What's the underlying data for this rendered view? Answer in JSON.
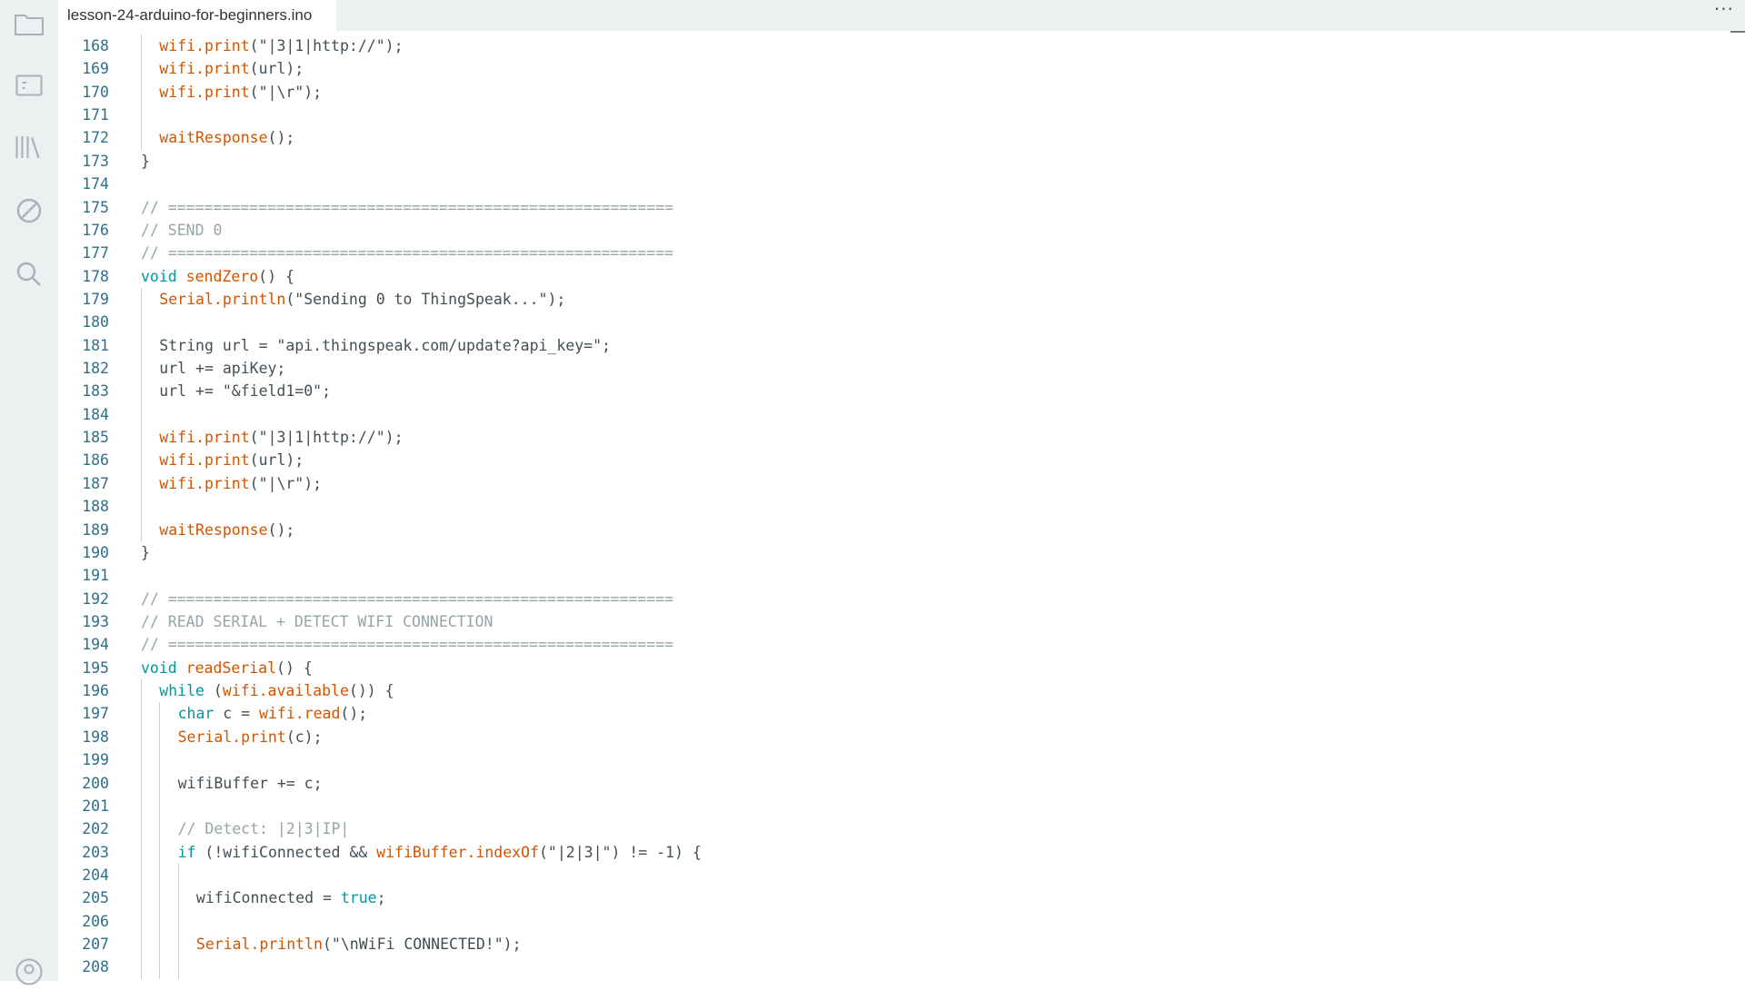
{
  "tab": {
    "filename": "lesson-24-arduino-for-beginners.ino",
    "more_label": "···"
  },
  "sidebar": {
    "items": [
      {
        "name": "folder-icon"
      },
      {
        "name": "board-icon"
      },
      {
        "name": "library-icon"
      },
      {
        "name": "debug-icon"
      },
      {
        "name": "search-icon"
      },
      {
        "name": "profile-icon"
      }
    ]
  },
  "code": {
    "lines": [
      {
        "n": "168",
        "indent": 1,
        "tokens": [
          [
            "fn",
            "wifi.print"
          ],
          [
            "p",
            "(\"|3|1|http://\");"
          ]
        ]
      },
      {
        "n": "169",
        "indent": 1,
        "tokens": [
          [
            "fn",
            "wifi.print"
          ],
          [
            "p",
            "(url);"
          ]
        ]
      },
      {
        "n": "170",
        "indent": 1,
        "tokens": [
          [
            "fn",
            "wifi.print"
          ],
          [
            "p",
            "(\"|\\r\");"
          ]
        ]
      },
      {
        "n": "171",
        "indent": 1,
        "tokens": []
      },
      {
        "n": "172",
        "indent": 1,
        "tokens": [
          [
            "fn",
            "waitResponse"
          ],
          [
            "p",
            "();"
          ]
        ]
      },
      {
        "n": "173",
        "indent": 0,
        "tokens": [
          [
            "p",
            "}"
          ]
        ]
      },
      {
        "n": "174",
        "indent": 0,
        "tokens": []
      },
      {
        "n": "175",
        "indent": 0,
        "tokens": [
          [
            "cm",
            "// ========================================================"
          ]
        ]
      },
      {
        "n": "176",
        "indent": 0,
        "tokens": [
          [
            "cm",
            "// SEND 0"
          ]
        ]
      },
      {
        "n": "177",
        "indent": 0,
        "tokens": [
          [
            "cm",
            "// ========================================================"
          ]
        ]
      },
      {
        "n": "178",
        "indent": 0,
        "tokens": [
          [
            "kw",
            "void "
          ],
          [
            "fn",
            "sendZero"
          ],
          [
            "p",
            "() {"
          ]
        ]
      },
      {
        "n": "179",
        "indent": 1,
        "tokens": [
          [
            "fn",
            "Serial.println"
          ],
          [
            "p",
            "(\"Sending 0 to ThingSpeak...\");"
          ]
        ]
      },
      {
        "n": "180",
        "indent": 1,
        "tokens": []
      },
      {
        "n": "181",
        "indent": 1,
        "tokens": [
          [
            "p",
            "String url = \"api.thingspeak.com/update?api_key=\";"
          ]
        ]
      },
      {
        "n": "182",
        "indent": 1,
        "tokens": [
          [
            "p",
            "url += apiKey;"
          ]
        ]
      },
      {
        "n": "183",
        "indent": 1,
        "tokens": [
          [
            "p",
            "url += \"&field1=0\";"
          ]
        ]
      },
      {
        "n": "184",
        "indent": 1,
        "tokens": []
      },
      {
        "n": "185",
        "indent": 1,
        "tokens": [
          [
            "fn",
            "wifi.print"
          ],
          [
            "p",
            "(\"|3|1|http://\");"
          ]
        ]
      },
      {
        "n": "186",
        "indent": 1,
        "tokens": [
          [
            "fn",
            "wifi.print"
          ],
          [
            "p",
            "(url);"
          ]
        ]
      },
      {
        "n": "187",
        "indent": 1,
        "tokens": [
          [
            "fn",
            "wifi.print"
          ],
          [
            "p",
            "(\"|\\r\");"
          ]
        ]
      },
      {
        "n": "188",
        "indent": 1,
        "tokens": []
      },
      {
        "n": "189",
        "indent": 1,
        "tokens": [
          [
            "fn",
            "waitResponse"
          ],
          [
            "p",
            "();"
          ]
        ]
      },
      {
        "n": "190",
        "indent": 0,
        "tokens": [
          [
            "p",
            "}"
          ]
        ]
      },
      {
        "n": "191",
        "indent": 0,
        "tokens": []
      },
      {
        "n": "192",
        "indent": 0,
        "tokens": [
          [
            "cm",
            "// ========================================================"
          ]
        ]
      },
      {
        "n": "193",
        "indent": 0,
        "tokens": [
          [
            "cm",
            "// READ SERIAL + DETECT WIFI CONNECTION"
          ]
        ]
      },
      {
        "n": "194",
        "indent": 0,
        "tokens": [
          [
            "cm",
            "// ========================================================"
          ]
        ]
      },
      {
        "n": "195",
        "indent": 0,
        "tokens": [
          [
            "kw",
            "void "
          ],
          [
            "fn",
            "readSerial"
          ],
          [
            "p",
            "() {"
          ]
        ]
      },
      {
        "n": "196",
        "indent": 1,
        "tokens": [
          [
            "kw",
            "while "
          ],
          [
            "p",
            "("
          ],
          [
            "fn",
            "wifi.available"
          ],
          [
            "p",
            "()) {"
          ]
        ]
      },
      {
        "n": "197",
        "indent": 2,
        "tokens": [
          [
            "type",
            "char "
          ],
          [
            "p",
            "c = "
          ],
          [
            "fn",
            "wifi.read"
          ],
          [
            "p",
            "();"
          ]
        ]
      },
      {
        "n": "198",
        "indent": 2,
        "tokens": [
          [
            "fn",
            "Serial.print"
          ],
          [
            "p",
            "(c);"
          ]
        ]
      },
      {
        "n": "199",
        "indent": 2,
        "tokens": []
      },
      {
        "n": "200",
        "indent": 2,
        "tokens": [
          [
            "p",
            "wifiBuffer += c;"
          ]
        ]
      },
      {
        "n": "201",
        "indent": 2,
        "tokens": []
      },
      {
        "n": "202",
        "indent": 2,
        "tokens": [
          [
            "cm",
            "// Detect: |2|3|IP|"
          ]
        ]
      },
      {
        "n": "203",
        "indent": 2,
        "tokens": [
          [
            "kw",
            "if "
          ],
          [
            "p",
            "(!wifiConnected && "
          ],
          [
            "fn",
            "wifiBuffer.indexOf"
          ],
          [
            "p",
            "(\"|2|3|\") != -1) {"
          ]
        ]
      },
      {
        "n": "204",
        "indent": 3,
        "tokens": []
      },
      {
        "n": "205",
        "indent": 3,
        "tokens": [
          [
            "p",
            "wifiConnected = "
          ],
          [
            "kw",
            "true"
          ],
          [
            "p",
            ";"
          ]
        ]
      },
      {
        "n": "206",
        "indent": 3,
        "tokens": []
      },
      {
        "n": "207",
        "indent": 3,
        "tokens": [
          [
            "fn",
            "Serial.println"
          ],
          [
            "p",
            "(\"\\nWiFi CONNECTED!\");"
          ]
        ]
      },
      {
        "n": "208",
        "indent": 3,
        "tokens": []
      }
    ]
  }
}
